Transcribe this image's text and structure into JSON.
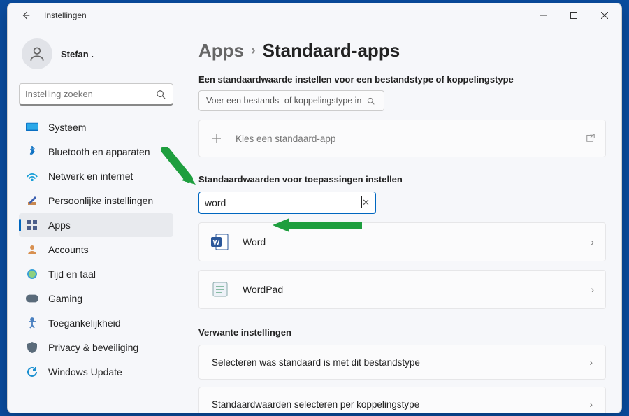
{
  "title": "Instellingen",
  "user": {
    "name": "Stefan ."
  },
  "search_placeholder": "Instelling zoeken",
  "nav": {
    "items": [
      {
        "id": "system",
        "label": "Systeem",
        "sel": false
      },
      {
        "id": "bluetooth",
        "label": "Bluetooth en apparaten",
        "sel": false
      },
      {
        "id": "network",
        "label": "Netwerk en internet",
        "sel": false
      },
      {
        "id": "personal",
        "label": "Persoonlijke instellingen",
        "sel": false
      },
      {
        "id": "apps",
        "label": "Apps",
        "sel": true
      },
      {
        "id": "accounts",
        "label": "Accounts",
        "sel": false
      },
      {
        "id": "time",
        "label": "Tijd en taal",
        "sel": false
      },
      {
        "id": "gaming",
        "label": "Gaming",
        "sel": false
      },
      {
        "id": "access",
        "label": "Toegankelijkheid",
        "sel": false
      },
      {
        "id": "privacy",
        "label": "Privacy & beveiliging",
        "sel": false
      },
      {
        "id": "update",
        "label": "Windows Update",
        "sel": false
      }
    ]
  },
  "crumb": {
    "parent": "Apps",
    "current": "Standaard-apps"
  },
  "section1_title": "Een standaardwaarde instellen voor een bestandstype of koppelingstype",
  "filetype_placeholder": "Voer een bestands- of koppelingstype in",
  "choose_card": "Kies een standaard-app",
  "section2_title": "Standaardwaarden voor toepassingen instellen",
  "app_search_value": "word",
  "apps": [
    {
      "id": "word",
      "label": "Word"
    },
    {
      "id": "wordpad",
      "label": "WordPad"
    }
  ],
  "related_title": "Verwante instellingen",
  "related": [
    {
      "label": "Selecteren was standaard is met dit bestandstype"
    },
    {
      "label": "Standaardwaarden selecteren per koppelingstype"
    }
  ]
}
